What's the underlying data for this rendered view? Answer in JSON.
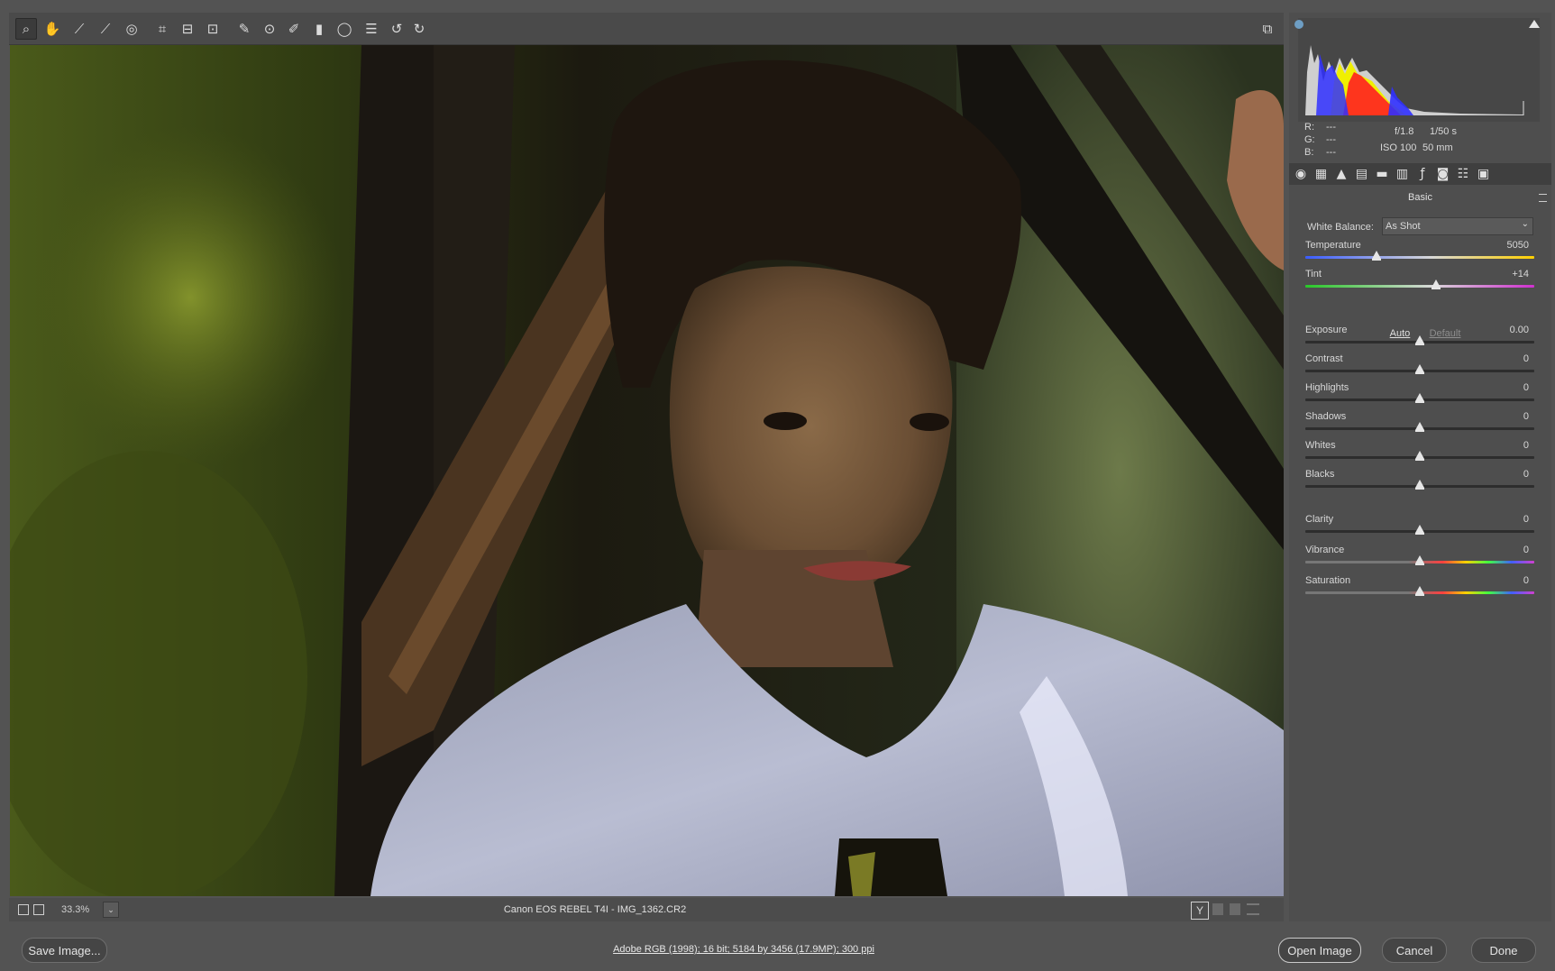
{
  "toolbar": {
    "tools": [
      {
        "name": "zoom-tool",
        "glyph": "⌕",
        "active": true
      },
      {
        "name": "hand-tool",
        "glyph": "✋"
      },
      {
        "name": "white-balance-tool",
        "glyph": "⟋"
      },
      {
        "name": "color-sampler-tool",
        "glyph": "⟋"
      },
      {
        "name": "targeted-adjustment-tool",
        "glyph": "◎"
      },
      {
        "name": "crop-tool",
        "glyph": "⌗"
      },
      {
        "name": "straighten-tool",
        "glyph": "⊟"
      },
      {
        "name": "transform-tool",
        "glyph": "⊡"
      },
      {
        "name": "spot-removal-tool",
        "glyph": "✎"
      },
      {
        "name": "red-eye-tool",
        "glyph": "⊙"
      },
      {
        "name": "adjustment-brush-tool",
        "glyph": "✐"
      },
      {
        "name": "graduated-filter-tool",
        "glyph": "▮"
      },
      {
        "name": "radial-filter-tool",
        "glyph": "◯"
      },
      {
        "name": "preferences-tool",
        "glyph": "☰"
      },
      {
        "name": "rotate-ccw-tool",
        "glyph": "↺"
      },
      {
        "name": "rotate-cw-tool",
        "glyph": "↻"
      }
    ],
    "fullscreen_icon": "⧉"
  },
  "status": {
    "zoom": "33.3%",
    "filename": "Canon EOS REBEL T4I  -  IMG_1362.CR2",
    "y_label": "Y"
  },
  "bottom": {
    "save_label": "Save Image...",
    "workflow_text": "Adobe RGB (1998); 16 bit; 5184 by 3456 (17.9MP); 300 ppi",
    "open_label": "Open Image",
    "cancel_label": "Cancel",
    "done_label": "Done"
  },
  "info": {
    "r_label": "R:",
    "g_label": "G:",
    "b_label": "B:",
    "r_val": "---",
    "g_val": "---",
    "b_val": "---",
    "aperture": "f/1.8",
    "shutter": "1/50 s",
    "iso": "ISO 100",
    "focal": "50 mm"
  },
  "panel": {
    "title": "Basic",
    "tabs": [
      "basic",
      "tone-curve",
      "detail",
      "hsl",
      "split-toning",
      "lens",
      "fx",
      "camera-calibration",
      "presets",
      "snapshots"
    ],
    "white_balance_label": "White Balance:",
    "white_balance_value": "As Shot",
    "auto_label": "Auto",
    "default_label": "Default",
    "sliders": [
      {
        "key": "temperature",
        "label": "Temperature",
        "value": "5050",
        "pos": 0.31,
        "style": "temp"
      },
      {
        "key": "tint",
        "label": "Tint",
        "value": "+14",
        "pos": 0.57,
        "style": "tint"
      },
      {
        "key": "exposure",
        "label": "Exposure",
        "value": "0.00",
        "pos": 0.5,
        "style": "plain"
      },
      {
        "key": "contrast",
        "label": "Contrast",
        "value": "0",
        "pos": 0.5,
        "style": "plain"
      },
      {
        "key": "highlights",
        "label": "Highlights",
        "value": "0",
        "pos": 0.5,
        "style": "plain"
      },
      {
        "key": "shadows",
        "label": "Shadows",
        "value": "0",
        "pos": 0.5,
        "style": "plain"
      },
      {
        "key": "whites",
        "label": "Whites",
        "value": "0",
        "pos": 0.5,
        "style": "plain"
      },
      {
        "key": "blacks",
        "label": "Blacks",
        "value": "0",
        "pos": 0.5,
        "style": "plain"
      },
      {
        "key": "clarity",
        "label": "Clarity",
        "value": "0",
        "pos": 0.5,
        "style": "plain"
      },
      {
        "key": "vibrance",
        "label": "Vibrance",
        "value": "0",
        "pos": 0.5,
        "style": "spectrum"
      },
      {
        "key": "saturation",
        "label": "Saturation",
        "value": "0",
        "pos": 0.5,
        "style": "spectrum"
      }
    ]
  },
  "colors": {
    "accent": "#e6e6e6",
    "histogram_red": "#ff2020",
    "histogram_yellow": "#f0f000",
    "histogram_blue": "#3030ff"
  }
}
